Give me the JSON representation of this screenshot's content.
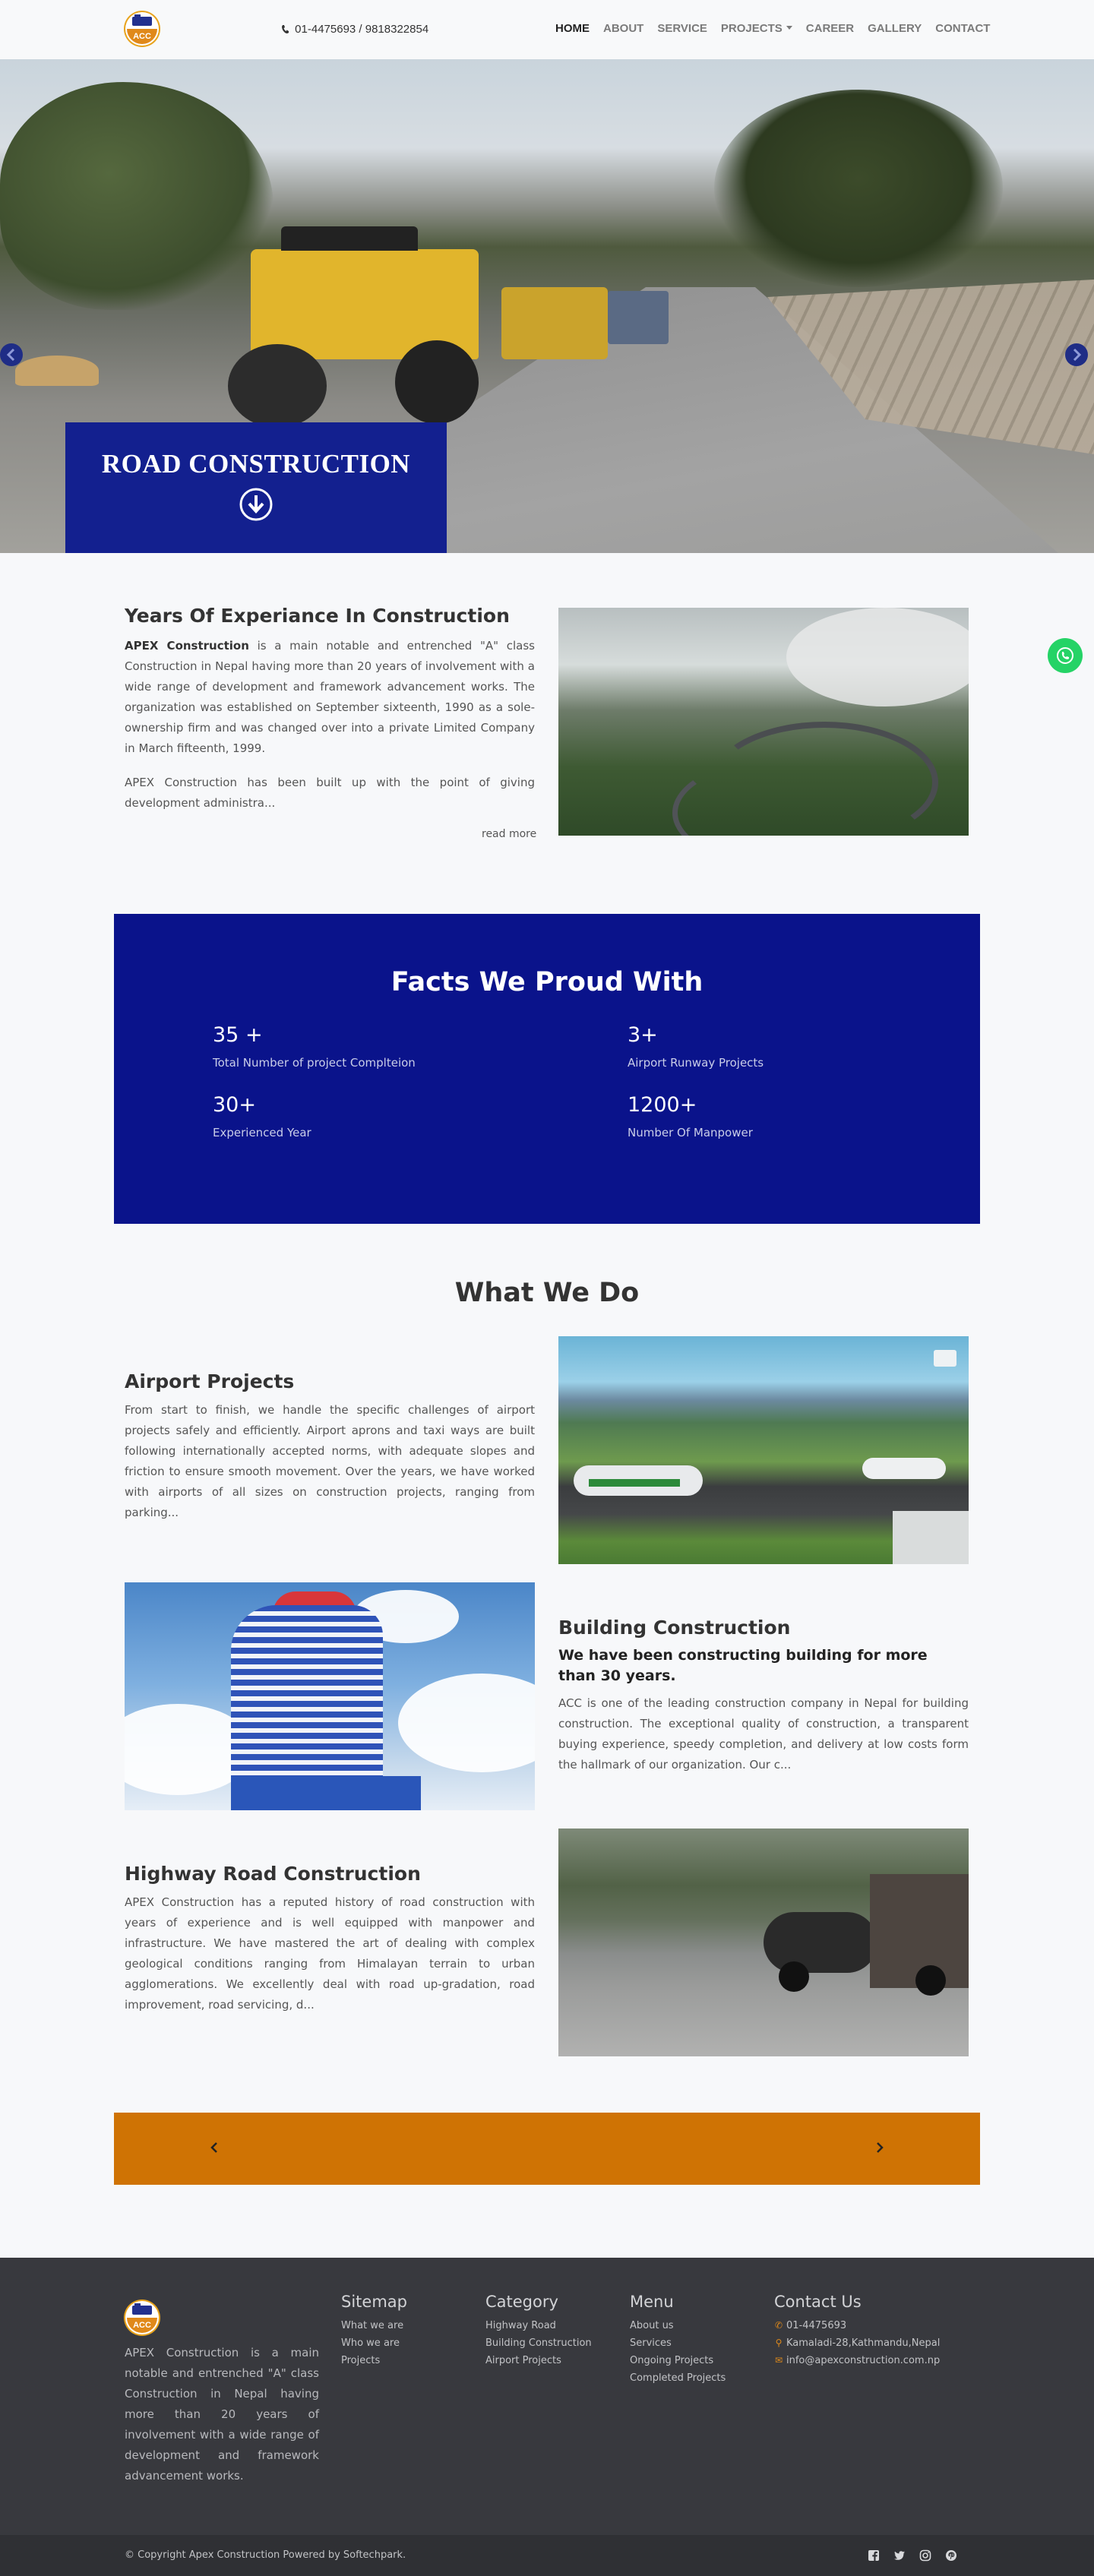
{
  "brand": {
    "logo_text": "ACC",
    "colors": {
      "navy": "#0a138b",
      "hero_caption": "#13208f",
      "gold": "#cf7304",
      "footer": "#38393e",
      "whatsapp": "#25d366"
    }
  },
  "header": {
    "phone": "01-4475693 / 9818322854",
    "nav": [
      {
        "label": "HOME",
        "active": true
      },
      {
        "label": "ABOUT"
      },
      {
        "label": "SERVICE"
      },
      {
        "label": "PROJECTS"
      },
      {
        "label": "CAREER"
      },
      {
        "label": "GALLERY"
      },
      {
        "label": "CONTACT"
      }
    ]
  },
  "hero": {
    "caption": "ROAD CONSTRUCTION"
  },
  "about": {
    "title": "Years Of Experiance In Construction",
    "company": "APEX Construction",
    "paragraph1": " is a main notable and entrenched \"A\" class Construction in Nepal having more than 20 years of involvement with a wide range of development and framework advancement works. The organization was established on September sixteenth, 1990 as a sole-ownership firm and was changed over into a private Limited Company in March fifteenth, 1999.",
    "paragraph2": "APEX Construction has been built up with the point of giving development administra...",
    "read_more": "read more"
  },
  "facts": {
    "title": "Facts We Proud With",
    "items": [
      {
        "value": "35 +",
        "label": "Total Number of project Complteion"
      },
      {
        "value": "3+",
        "label": "Airport Runway Projects"
      },
      {
        "value": "30+",
        "label": "Experienced Year"
      },
      {
        "value": "1200+",
        "label": "Number Of Manpower"
      }
    ]
  },
  "what_we_do": {
    "title": "What We Do",
    "services": [
      {
        "title": "Airport Projects",
        "text": "From start to finish, we handle the specific challenges of airport projects safely and efficiently. Airport aprons and taxi ways are built following internationally accepted norms, with adequate slopes and friction to ensure smooth movement. Over the years, we have worked with airports of all sizes on construction projects, ranging from parking..."
      },
      {
        "title": "Building Construction",
        "subtitle": "We have been constructing building for more than 30 years.",
        "text": "ACC is one of the leading construction company in Nepal for building construction. The exceptional quality of construction, a transparent buying experience, speedy completion, and delivery at low costs form the hallmark of our organization. Our c..."
      },
      {
        "title": "Highway Road Construction",
        "text": "APEX Construction has a reputed history of road construction with years of experience and is well equipped with manpower and infrastructure. We have mastered the art of dealing with complex geological conditions ranging from Himalayan terrain to urban agglomerations. We excellently deal with road up-gradation, road improvement, road servicing, d..."
      }
    ]
  },
  "footer": {
    "description": "APEX Construction is a main notable and entrenched \"A\" class Construction in Nepal having more than 20 years of involvement with a wide range of development and framework advancement works.",
    "sitemap": {
      "title": "Sitemap",
      "links": [
        "What we are",
        "Who we are",
        "Projects"
      ]
    },
    "category": {
      "title": "Category",
      "links": [
        "Highway Road",
        "Building Construction",
        "Airport Projects"
      ]
    },
    "menu": {
      "title": "Menu",
      "links": [
        "About us",
        "Services",
        "Ongoing Projects",
        "Completed Projects"
      ]
    },
    "contact": {
      "title": "Contact Us",
      "phone": "01-4475693",
      "address": "Kamaladi-28,Kathmandu,Nepal",
      "email": "info@apexconstruction.com.np"
    },
    "copyright": "© Copyright Apex Construction Powered by Softechpark.",
    "social_icons": [
      "facebook-icon",
      "twitter-icon",
      "instagram-icon",
      "pinterest-icon"
    ]
  }
}
